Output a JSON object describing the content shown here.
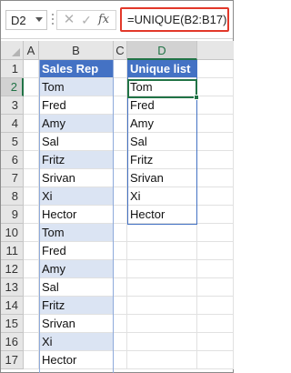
{
  "formula_bar": {
    "name_box": "D2",
    "fx_label": "fx",
    "cancel_glyph": "✕",
    "enter_glyph": "✓",
    "formula": "=UNIQUE(B2:B17)"
  },
  "columns": [
    "A",
    "B",
    "C",
    "D"
  ],
  "active_column": "D",
  "active_row": 2,
  "rows": [
    "1",
    "2",
    "3",
    "4",
    "5",
    "6",
    "7",
    "8",
    "9",
    "10",
    "11",
    "12",
    "13",
    "14",
    "15",
    "16",
    "17"
  ],
  "sales_rep": {
    "header": "Sales Rep",
    "values": [
      "Tom",
      "Fred",
      "Amy",
      "Sal",
      "Fritz",
      "Srivan",
      "Xi",
      "Hector",
      "Tom",
      "Fred",
      "Amy",
      "Sal",
      "Fritz",
      "Srivan",
      "Xi",
      "Hector"
    ]
  },
  "unique_list": {
    "header": "Unique list",
    "values": [
      "Tom",
      "Fred",
      "Amy",
      "Sal",
      "Fritz",
      "Srivan",
      "Xi",
      "Hector"
    ]
  },
  "colors": {
    "header_fill": "#4472c4",
    "band_fill": "#dbe4f3",
    "active_green": "#217346",
    "formula_highlight": "#e2382a"
  }
}
